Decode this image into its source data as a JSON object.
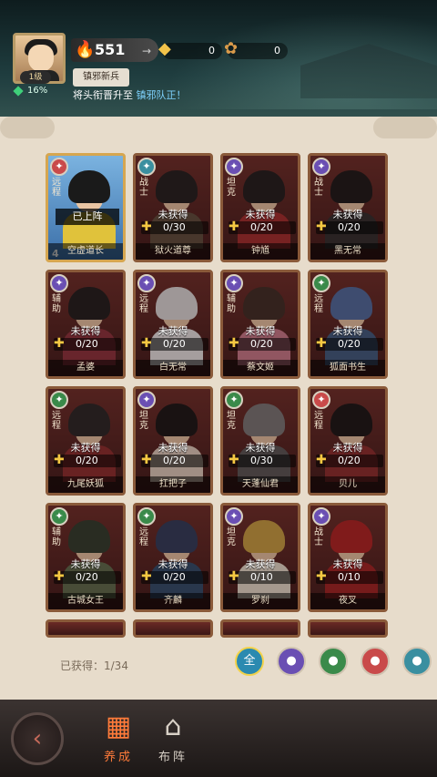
{
  "header": {
    "level": "1级",
    "xp_percent": "16%",
    "power": "551",
    "resources": [
      {
        "icon": "coin-bag-icon",
        "value": "0"
      },
      {
        "icon": "scroll-icon",
        "value": "0"
      }
    ],
    "title_badge": "镇邪新兵",
    "marquee_prefix": "将头衔晋升至",
    "marquee_highlight": "镇邪队正！"
  },
  "cards": [
    {
      "cls": "远程",
      "status": "已上阵",
      "name": "空虚道长",
      "owned": true,
      "stars": "4",
      "icon_color": "#c94a4a",
      "hair": "#1a1a1a",
      "body": "#e0c23b"
    },
    {
      "cls": "战士",
      "status": "未获得",
      "progress": "0/30",
      "name": "狱火道尊",
      "icon_color": "#3a8fa0",
      "hair": "#1b1b1b",
      "body": "#5a4a3a"
    },
    {
      "cls": "坦克",
      "status": "未获得",
      "progress": "0/20",
      "name": "钟馗",
      "icon_color": "#6a4fb3",
      "hair": "#1a1a1a",
      "body": "#a12a2a"
    },
    {
      "cls": "战士",
      "status": "未获得",
      "progress": "0/20",
      "name": "黑无常",
      "icon_color": "#6a4fb3",
      "hair": "#151515",
      "body": "#2a2a2a"
    },
    {
      "cls": "辅助",
      "status": "未获得",
      "progress": "0/20",
      "name": "孟婆",
      "icon_color": "#6a4fb3",
      "hair": "#1a1a1a",
      "body": "#8a2f3a"
    },
    {
      "cls": "远程",
      "status": "未获得",
      "progress": "0/20",
      "name": "白无常",
      "icon_color": "#6a4fb3",
      "hair": "#ddd",
      "body": "#e8e8e8"
    },
    {
      "cls": "辅助",
      "status": "未获得",
      "progress": "0/20",
      "name": "蔡文姬",
      "icon_color": "#6a4fb3",
      "hair": "#3a2a22",
      "body": "#c97a8a"
    },
    {
      "cls": "远程",
      "status": "未获得",
      "progress": "0/20",
      "name": "狐面书生",
      "icon_color": "#3a8a4a",
      "hair": "#4a6aa0",
      "body": "#3a5a80"
    },
    {
      "cls": "远程",
      "status": "未获得",
      "progress": "0/20",
      "name": "九尾妖狐",
      "icon_color": "#3a8a4a",
      "hair": "#222",
      "body": "#8a2a2a"
    },
    {
      "cls": "坦克",
      "status": "未获得",
      "progress": "0/20",
      "name": "扛把子",
      "icon_color": "#6a4fb3",
      "hair": "#111",
      "body": "#e0d0c0"
    },
    {
      "cls": "坦克",
      "status": "未获得",
      "progress": "0/30",
      "name": "天蓬仙君",
      "icon_color": "#3a8a4a",
      "hair": "#777",
      "body": "#555"
    },
    {
      "cls": "远程",
      "status": "未获得",
      "progress": "0/20",
      "name": "贝儿",
      "icon_color": "#c94a4a",
      "hair": "#111",
      "body": "#8a2a2a"
    },
    {
      "cls": "辅助",
      "status": "未获得",
      "progress": "0/20",
      "name": "古城女王",
      "icon_color": "#3a8a4a",
      "hair": "#2a3a2a",
      "body": "#5a6a4a"
    },
    {
      "cls": "远程",
      "status": "未获得",
      "progress": "0/20",
      "name": "齐麟",
      "icon_color": "#3a8a4a",
      "hair": "#2a3a5a",
      "body": "#2a4a6a"
    },
    {
      "cls": "坦克",
      "status": "未获得",
      "progress": "0/10",
      "name": "罗刹",
      "icon_color": "#6a4fb3",
      "hair": "#c9a040",
      "body": "#e8e0d0"
    },
    {
      "cls": "战士",
      "status": "未获得",
      "progress": "0/10",
      "name": "夜叉",
      "icon_color": "#6a4fb3",
      "hair": "#b02020",
      "body": "#a02020"
    }
  ],
  "footer": {
    "obtained_label": "已获得：1/34",
    "filters": [
      {
        "label": "全",
        "icon": "all-filter-icon",
        "color": "#2b8ab0"
      },
      {
        "label": "",
        "icon": "ghost-class-icon",
        "color": "#6a4fb3"
      },
      {
        "label": "",
        "icon": "spirit-class-icon",
        "color": "#3a8a4a"
      },
      {
        "label": "",
        "icon": "feather-class-icon",
        "color": "#c94a4a"
      },
      {
        "label": "",
        "icon": "swirl-class-icon",
        "color": "#3a8fa0"
      }
    ]
  },
  "nav": {
    "tabs": [
      {
        "label": "养成",
        "icon": "cards-icon",
        "active": true
      },
      {
        "label": "布阵",
        "icon": "formation-icon",
        "active": false
      }
    ]
  }
}
